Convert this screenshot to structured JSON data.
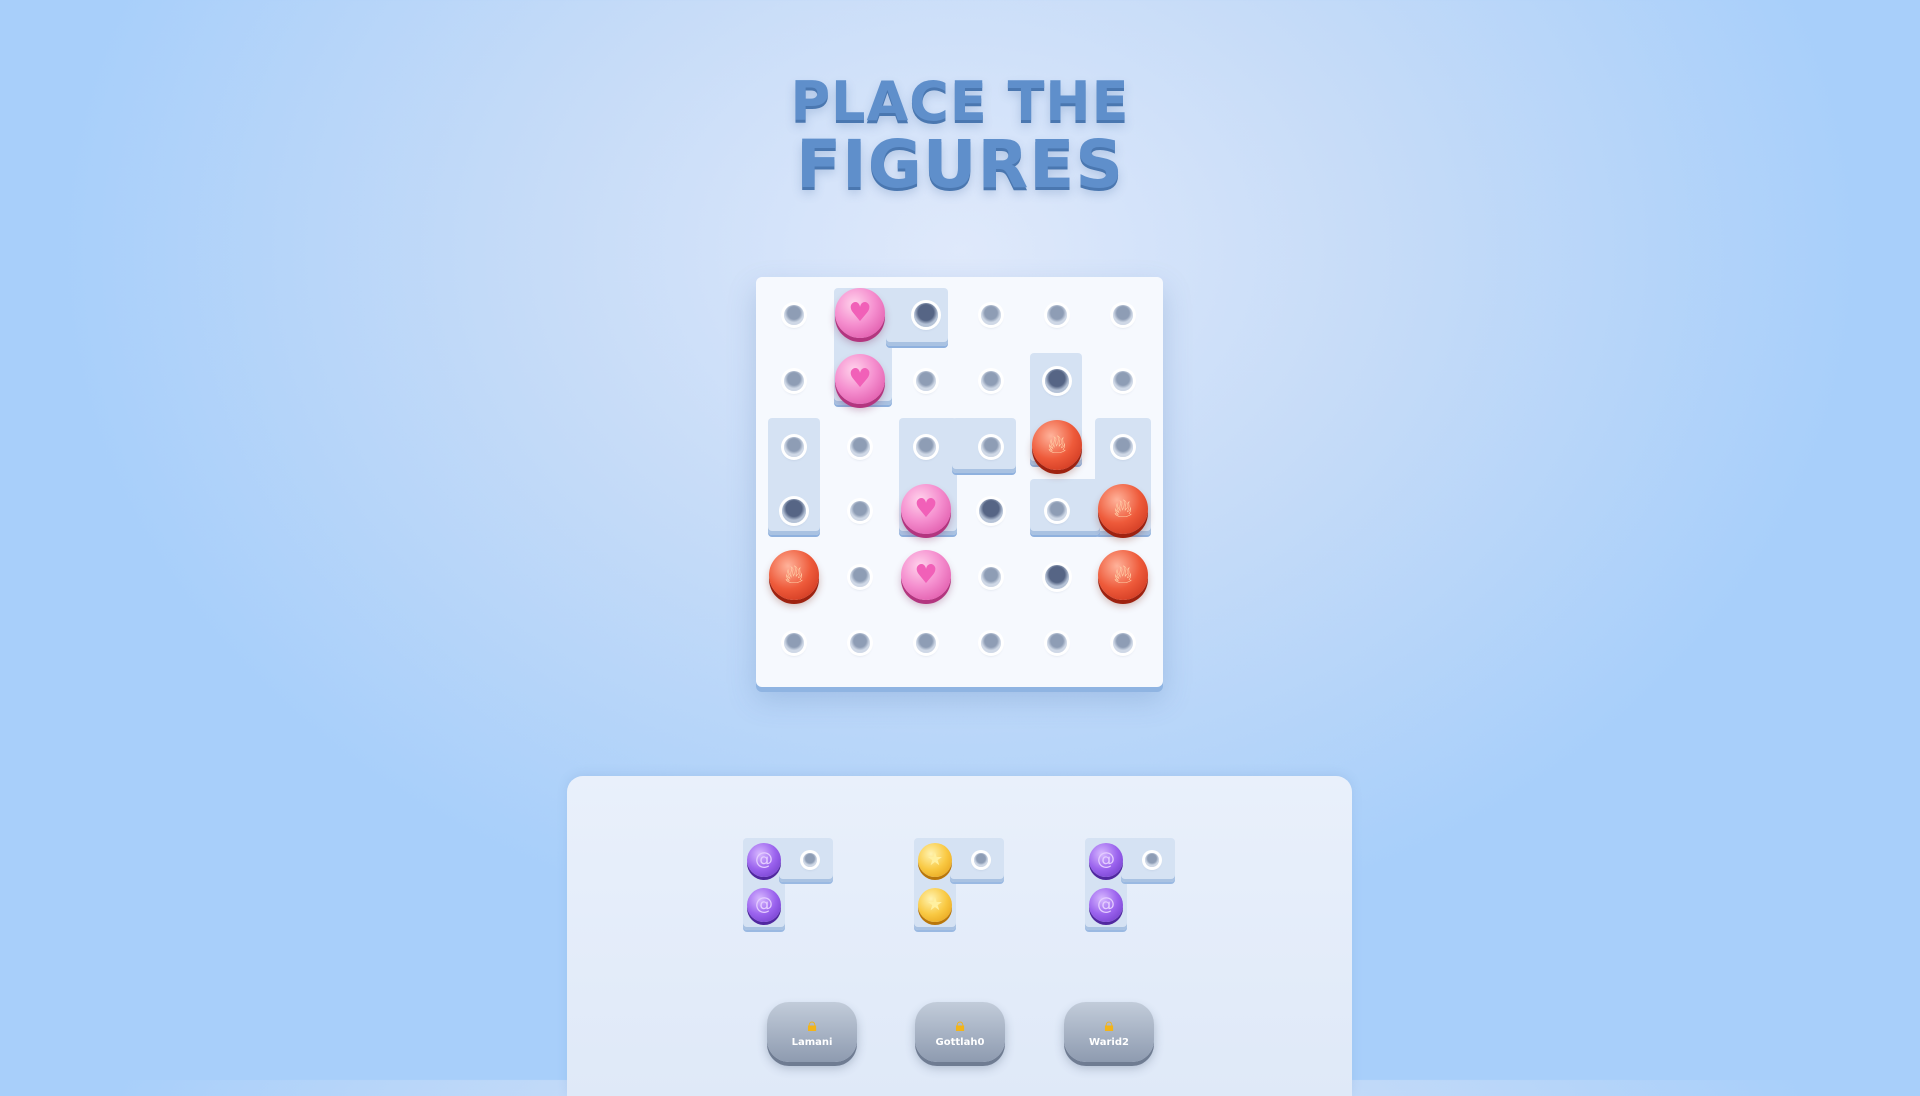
{
  "title": {
    "line1": "PLACE THE",
    "line2": "FIGURES"
  },
  "board": {
    "rows": 6,
    "cols": 6,
    "tokens": [
      {
        "row": 0,
        "col": 1,
        "type": "heart",
        "color": "pink"
      },
      {
        "row": 1,
        "col": 1,
        "type": "heart",
        "color": "pink"
      },
      {
        "row": 2,
        "col": 4,
        "type": "flame",
        "color": "red"
      },
      {
        "row": 3,
        "col": 2,
        "type": "heart",
        "color": "pink"
      },
      {
        "row": 3,
        "col": 5,
        "type": "flame",
        "color": "red"
      },
      {
        "row": 4,
        "col": 0,
        "type": "flame",
        "color": "red"
      },
      {
        "row": 4,
        "col": 2,
        "type": "heart",
        "color": "pink"
      },
      {
        "row": 4,
        "col": 5,
        "type": "flame",
        "color": "red"
      }
    ]
  },
  "tray": {
    "pieces": [
      {
        "name": "purple-piece-1",
        "color": "purple",
        "icon": "swirl"
      },
      {
        "name": "yellow-piece",
        "color": "yellow",
        "icon": "star"
      },
      {
        "name": "purple-piece-2",
        "color": "purple",
        "icon": "swirl"
      }
    ],
    "lock_buttons": [
      {
        "label": "Lamani",
        "icon": "lock-icon"
      },
      {
        "label": "Gottlah0",
        "icon": "lock-icon"
      },
      {
        "label": "Warid2",
        "icon": "lock-icon"
      }
    ]
  },
  "colors": {
    "pink": "#f58fcf",
    "red": "#ee5a3a",
    "purple": "#9b63ee",
    "yellow": "#f9c943",
    "title": "#5f8fcb"
  }
}
